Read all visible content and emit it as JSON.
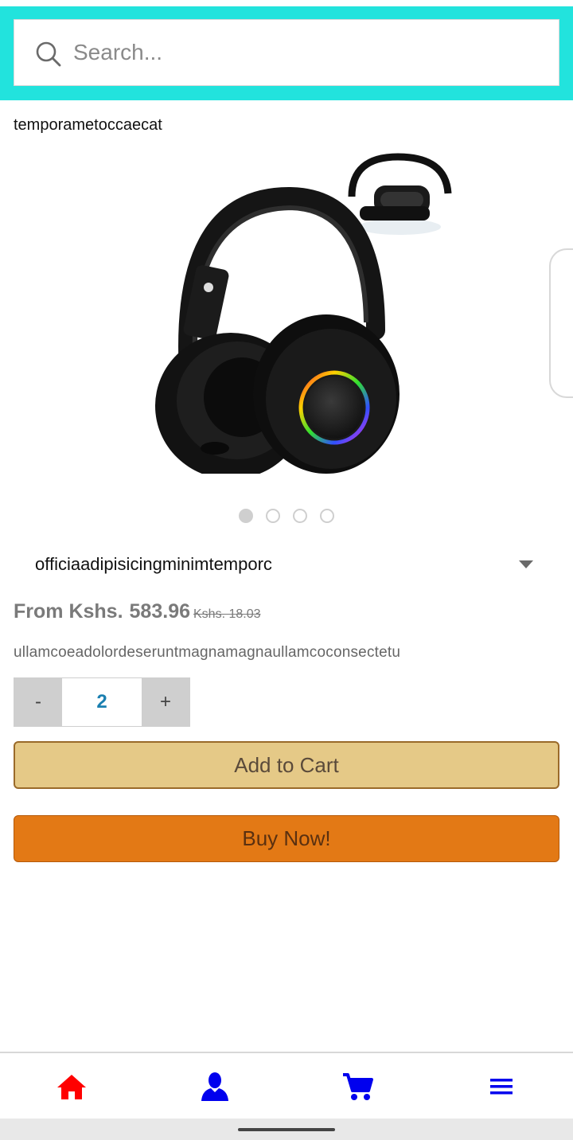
{
  "search": {
    "placeholder": "Search...",
    "value": ""
  },
  "store": {
    "title": "temporametoccaecat"
  },
  "product": {
    "image_icon": "headphones-image",
    "carousel": {
      "count": 4,
      "active_index": 0
    },
    "variant": {
      "selected": "officiaadipisicingminimtemporc"
    },
    "price": {
      "prefix": "From Kshs.",
      "current": "583.96",
      "original": "Kshs. 18.03"
    },
    "description": "ullamcoeadolordeseruntmagnamagnaullamcoconsectetu",
    "quantity": {
      "minus_label": "-",
      "value": "2",
      "plus_label": "+"
    }
  },
  "actions": {
    "add_to_cart": "Add to Cart",
    "buy_now": "Buy Now!"
  },
  "bottom_nav": {
    "items": [
      {
        "icon": "home-icon",
        "color": "#ff0000"
      },
      {
        "icon": "user-icon",
        "color": "#0000ee"
      },
      {
        "icon": "cart-icon",
        "color": "#0000ee"
      },
      {
        "icon": "menu-icon",
        "color": "#0000ee"
      }
    ]
  },
  "colors": {
    "search_band": "#22e3dd",
    "add_to_cart_bg": "#e5c987",
    "buy_now_bg": "#e37915",
    "quantity_value": "#1a7fb0"
  }
}
